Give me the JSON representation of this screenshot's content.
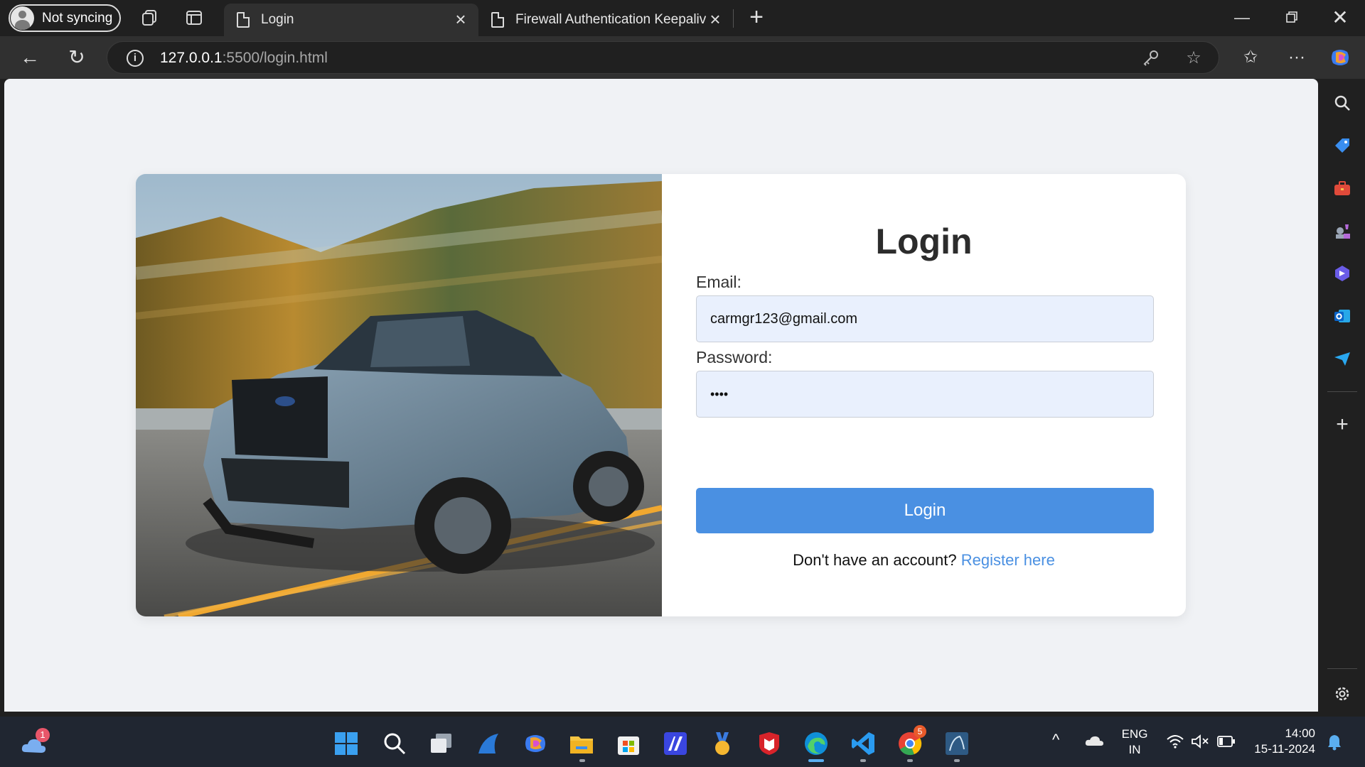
{
  "browser": {
    "profile_label": "Not syncing",
    "tabs": [
      {
        "title": "Login",
        "active": true
      },
      {
        "title": "Firewall Authentication Keepalive",
        "active": false
      }
    ],
    "url_host": "127.0.0.1",
    "url_rest": ":5500/login.html"
  },
  "page": {
    "title": "Login",
    "email_label": "Email:",
    "email_value": "carmgr123@gmail.com",
    "password_label": "Password:",
    "password_value": "••••",
    "submit_label": "Login",
    "footer_prefix": "Don't have an account?",
    "register_link": "Register here",
    "accent_color": "#4a90e2"
  },
  "taskbar": {
    "weather_badge": "1",
    "chrome_badge": "5",
    "lang_line1": "ENG",
    "lang_line2": "IN",
    "time": "14:00",
    "date": "15-11-2024"
  }
}
